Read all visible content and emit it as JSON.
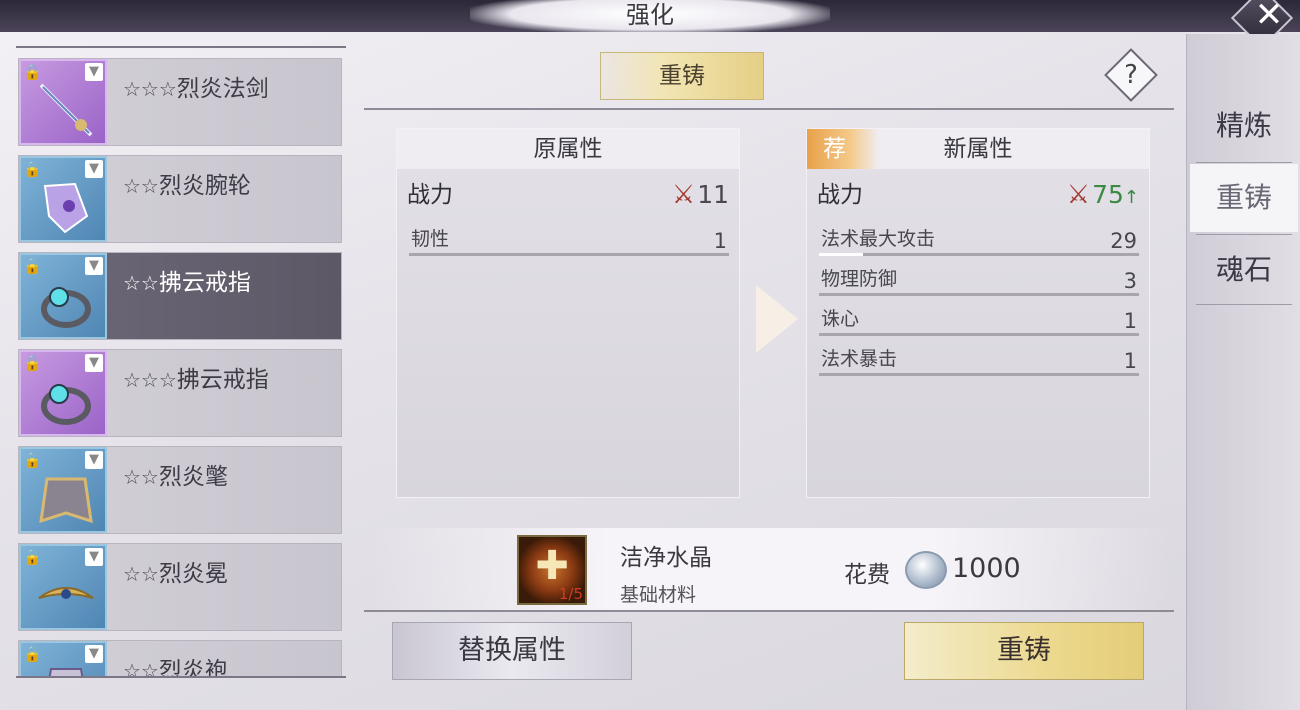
{
  "window": {
    "title": "强化",
    "close_icon": "close-icon"
  },
  "equipment_list": [
    {
      "stars": "☆☆☆",
      "name": "烈炎法剑",
      "frame": "purple",
      "selected": false
    },
    {
      "stars": "☆☆",
      "name": "烈炎腕轮",
      "frame": "blue",
      "selected": false
    },
    {
      "stars": "☆☆",
      "name": "拂云戒指",
      "frame": "blue",
      "selected": true
    },
    {
      "stars": "☆☆☆",
      "name": "拂云戒指",
      "frame": "purple",
      "selected": false
    },
    {
      "stars": "☆☆",
      "name": "烈炎氅",
      "frame": "blue",
      "selected": false
    },
    {
      "stars": "☆☆",
      "name": "烈炎冕",
      "frame": "blue",
      "selected": false
    },
    {
      "stars": "☆☆",
      "name": "烈炎袍",
      "frame": "blue",
      "selected": false
    }
  ],
  "sub_tab": {
    "label": "重铸"
  },
  "help": {
    "label": "?"
  },
  "old_attrs": {
    "title": "原属性",
    "power_label": "战力",
    "power_value": "11",
    "rows": [
      {
        "label": "韧性",
        "value": "1"
      }
    ]
  },
  "new_attrs": {
    "badge": "荐",
    "title": "新属性",
    "power_label": "战力",
    "power_value": "75",
    "power_trend": "↑",
    "rows": [
      {
        "label": "法术最大攻击",
        "value": "29"
      },
      {
        "label": "物理防御",
        "value": "3"
      },
      {
        "label": "诛心",
        "value": "1"
      },
      {
        "label": "法术暴击",
        "value": "1"
      }
    ]
  },
  "material": {
    "name": "洁净水晶",
    "type": "基础材料",
    "count": "1/5"
  },
  "cost": {
    "label": "花费",
    "value": "1000"
  },
  "buttons": {
    "replace": "替换属性",
    "reforge": "重铸"
  },
  "side_tabs": [
    {
      "label": "精炼",
      "active": false
    },
    {
      "label": "重铸",
      "active": true
    },
    {
      "label": "魂石",
      "active": false
    }
  ],
  "colors": {
    "accent_gold": "#e4cd78",
    "power_up_green": "#3a8a42",
    "sword_red": "#a33a32",
    "recommend_orange": "#e8a14a"
  }
}
